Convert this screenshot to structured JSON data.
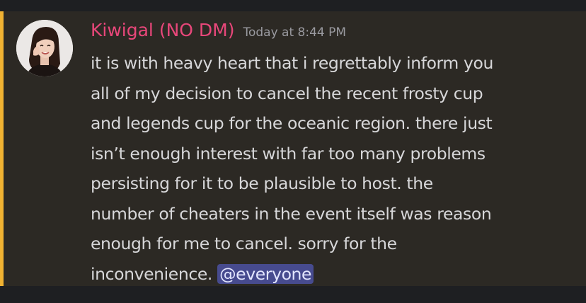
{
  "message": {
    "username": "Kiwigal (NO DM)",
    "timestamp": "Today at 8:44 PM",
    "lines": [
      "it is with heavy heart that i regrettably inform you",
      "all of my decision to cancel the recent frosty cup",
      "and legends cup for the oceanic region. there just",
      "isn’t enough interest with far too many problems",
      "persisting for it to be plausible to host. the",
      "number of cheaters in the event itself was reason",
      "enough for me to cancel. sorry for the",
      "inconvenience. "
    ],
    "mention": "@everyone"
  },
  "colors": {
    "background": "#2c2924",
    "mention_bar": "#f0b232",
    "username": "#e8477a",
    "timestamp": "#9a9aa0",
    "text": "#d7d7d9",
    "mention_bg": "#474b8f"
  }
}
